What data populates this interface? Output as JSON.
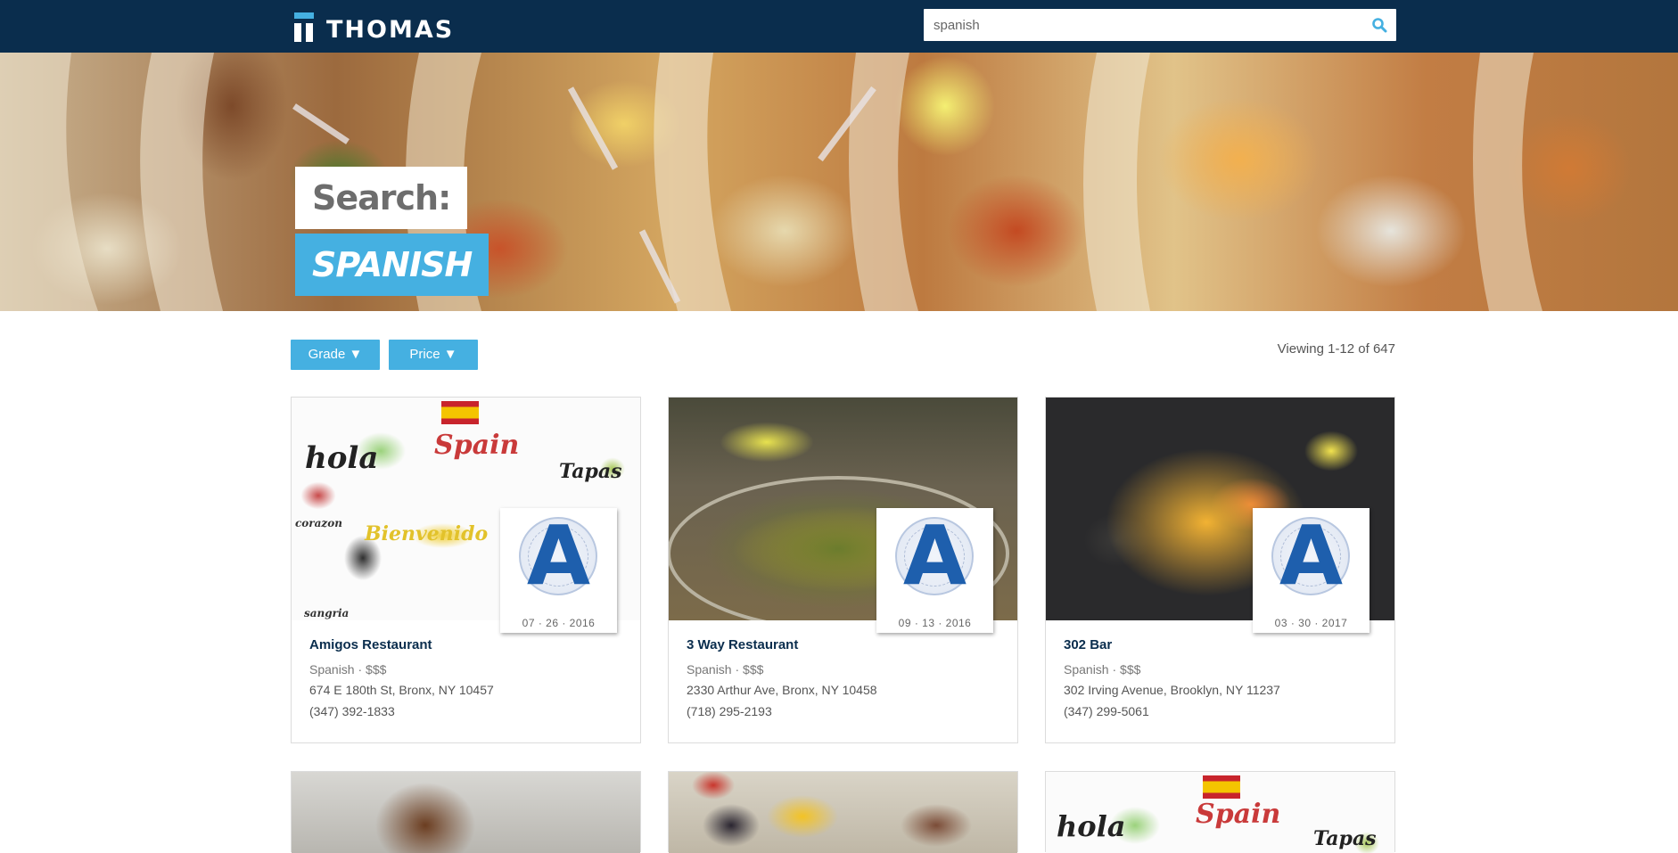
{
  "header": {
    "logo_text": "THOMAS",
    "search": {
      "value": "spanish",
      "placeholder": ""
    }
  },
  "hero": {
    "label": "Search:",
    "query": "SPANISH"
  },
  "filters": {
    "grade_label": "Grade ▼",
    "price_label": "Price ▼",
    "viewing_text": "Viewing 1-12 of 647"
  },
  "cards": [
    {
      "name": "Amigos Restaurant",
      "meta": "Spanish · $$$",
      "address": "674 E 180th St, Bronx, NY 10457",
      "phone": "(347) 392-1833",
      "grade": "A",
      "grade_date": "07 · 26 · 2016"
    },
    {
      "name": "3 Way Restaurant",
      "meta": "Spanish · $$$",
      "address": "2330 Arthur Ave, Bronx, NY 10458",
      "phone": "(718) 295-2193",
      "grade": "A",
      "grade_date": "09 · 13 · 2016"
    },
    {
      "name": "302 Bar",
      "meta": "Spanish · $$$",
      "address": "302 Irving Avenue, Brooklyn, NY 11237",
      "phone": "(347) 299-5061",
      "grade": "A",
      "grade_date": "03 · 30 · 2017"
    }
  ],
  "sketch_words": {
    "hola": "hola",
    "spain": "Spain",
    "tapas": "Tapas",
    "bienvenido": "Bienvenido",
    "corazon": "corazon",
    "sangria": "sangria"
  },
  "colors": {
    "nav_bg": "#0a2d4d",
    "accent": "#45b0e1",
    "grade_blue": "#1e5fad"
  }
}
